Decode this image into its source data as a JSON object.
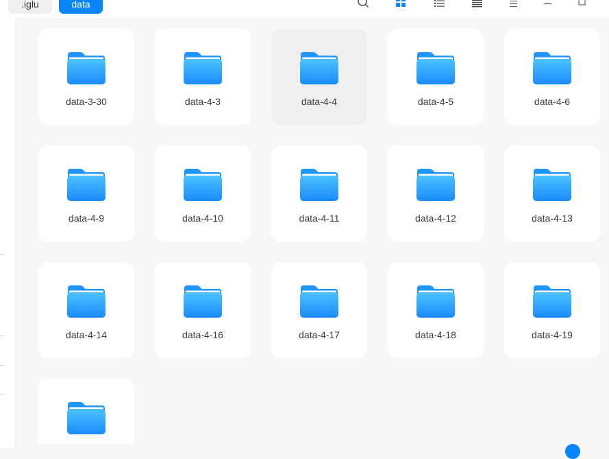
{
  "breadcrumbs": [
    {
      "label": ".iglu",
      "active": false
    },
    {
      "label": "data",
      "active": true
    }
  ],
  "toolbar": {
    "icons": [
      "search-icon",
      "icon-view-icon",
      "list-view-icon",
      "detail-view-icon",
      "menu-icon",
      "minimize-icon",
      "maximize-icon"
    ],
    "active_view": "icon-view",
    "accent": "#0a84ff"
  },
  "folders": [
    {
      "name": "data-3-30",
      "selected": false
    },
    {
      "name": "data-4-3",
      "selected": false
    },
    {
      "name": "data-4-4",
      "selected": true
    },
    {
      "name": "data-4-5",
      "selected": false
    },
    {
      "name": "data-4-6",
      "selected": false
    },
    {
      "name": "data-4-9",
      "selected": false
    },
    {
      "name": "data-4-10",
      "selected": false
    },
    {
      "name": "data-4-11",
      "selected": false
    },
    {
      "name": "data-4-12",
      "selected": false
    },
    {
      "name": "data-4-13",
      "selected": false
    },
    {
      "name": "data-4-14",
      "selected": false
    },
    {
      "name": "data-4-16",
      "selected": false
    },
    {
      "name": "data-4-17",
      "selected": false
    },
    {
      "name": "data-4-18",
      "selected": false
    },
    {
      "name": "data-4-19",
      "selected": false
    },
    {
      "name": "",
      "selected": false
    }
  ],
  "colors": {
    "folder_top": "#4cc2ff",
    "folder_bottom": "#1a8cff",
    "folder_back": "#1f95ff"
  }
}
